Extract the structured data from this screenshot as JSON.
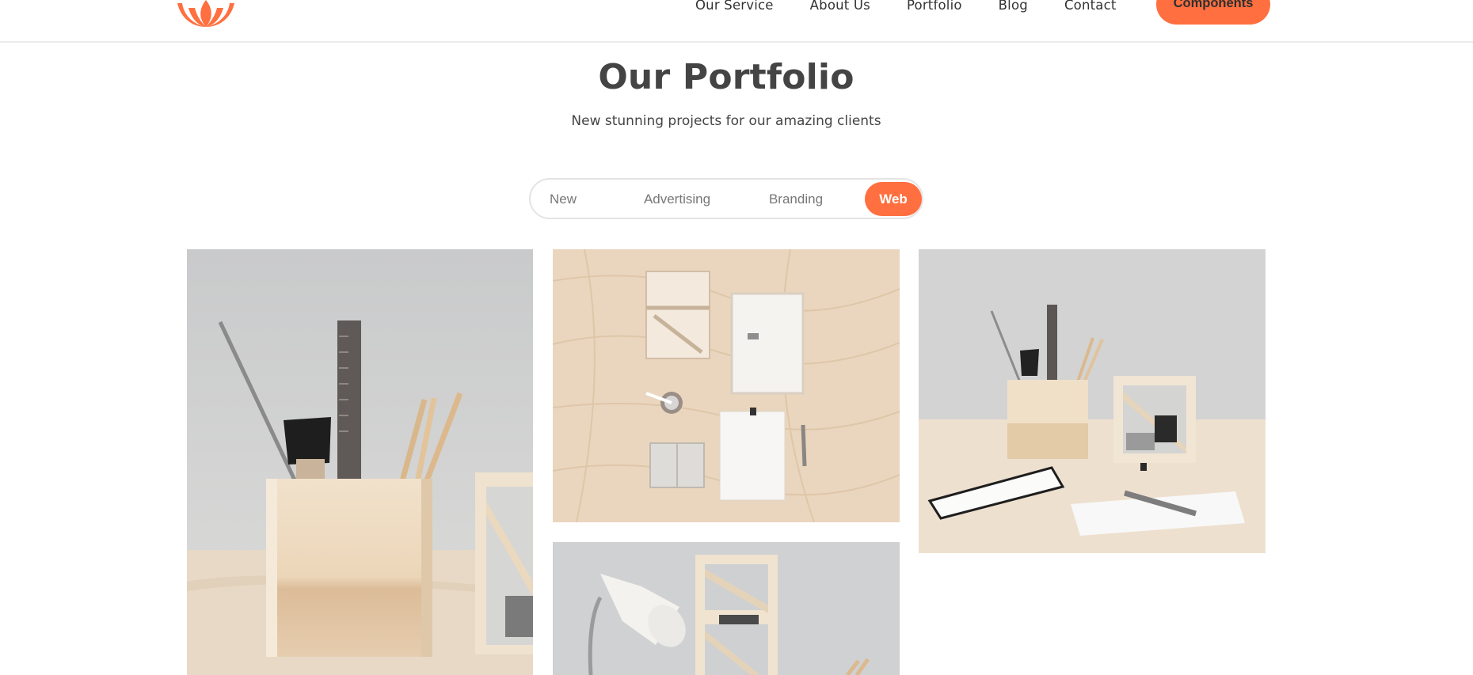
{
  "nav": {
    "links": [
      "Our Service",
      "About Us",
      "Portfolio",
      "Blog",
      "Contact"
    ],
    "cta_label": "Components"
  },
  "hero": {
    "title": "Our Portfolio",
    "subtitle": "New stunning projects for our amazing clients"
  },
  "filters": {
    "tabs": [
      "New",
      "Advertising",
      "Branding",
      "Web"
    ],
    "active": "Web"
  },
  "colors": {
    "accent": "#ff6f3f",
    "heading": "#444444",
    "muted_tab": "#777777"
  },
  "gallery": {
    "items": [
      {
        "icon": "desk-organizer-closeup-image"
      },
      {
        "icon": "desk-flatlay-image"
      },
      {
        "icon": "desk-organizer-wide-image"
      },
      {
        "icon": "desk-lamp-shelf-image"
      }
    ]
  }
}
